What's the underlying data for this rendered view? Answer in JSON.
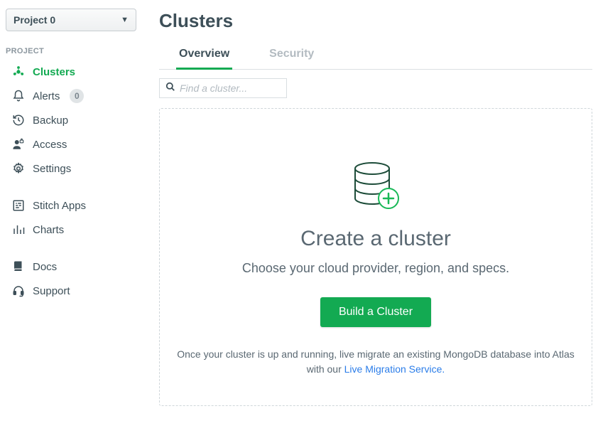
{
  "projectSelector": {
    "label": "Project 0"
  },
  "sectionLabel": "PROJECT",
  "sidebar": {
    "items": [
      {
        "label": "Clusters"
      },
      {
        "label": "Alerts",
        "badge": "0"
      },
      {
        "label": "Backup"
      },
      {
        "label": "Access"
      },
      {
        "label": "Settings"
      }
    ],
    "group2": [
      {
        "label": "Stitch Apps"
      },
      {
        "label": "Charts"
      }
    ],
    "group3": [
      {
        "label": "Docs"
      },
      {
        "label": "Support"
      }
    ]
  },
  "page": {
    "title": "Clusters"
  },
  "tabs": [
    {
      "label": "Overview"
    },
    {
      "label": "Security"
    }
  ],
  "search": {
    "placeholder": "Find a cluster..."
  },
  "empty": {
    "title": "Create a cluster",
    "subtitle": "Choose your cloud provider, region, and specs.",
    "button": "Build a Cluster",
    "footerPre": "Once your cluster is up and running, live migrate an existing MongoDB database into Atlas with our ",
    "footerLink": "Live Migration Service.",
    "footerPost": ""
  }
}
